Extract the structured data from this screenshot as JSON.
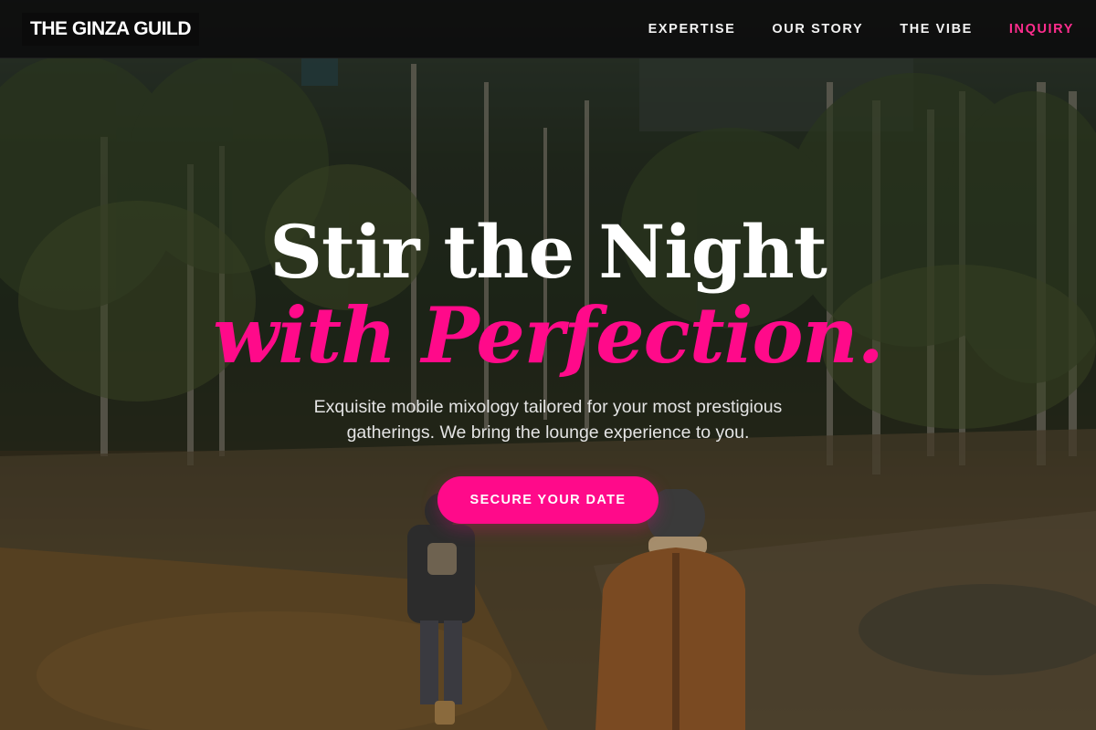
{
  "navbar": {
    "brand": "THE GINZA GUILD",
    "links": [
      {
        "label": "EXPERTISE"
      },
      {
        "label": "OUR STORY"
      },
      {
        "label": "THE VIBE"
      },
      {
        "label": "INQUIRY"
      }
    ]
  },
  "hero": {
    "headline_line1": "Stir the Night",
    "headline_line2": "with Perfection.",
    "subtitle": "Exquisite mobile mixology tailored for your most prestigious gatherings. We bring the lounge experience to you.",
    "cta_label": "SECURE YOUR DATE"
  },
  "colors": {
    "accent": "#ff0a8a",
    "navbar_bg": "#0c0c0c",
    "text_light": "#ffffff"
  },
  "icons": {
    "background_image": "forest-path-photo"
  }
}
